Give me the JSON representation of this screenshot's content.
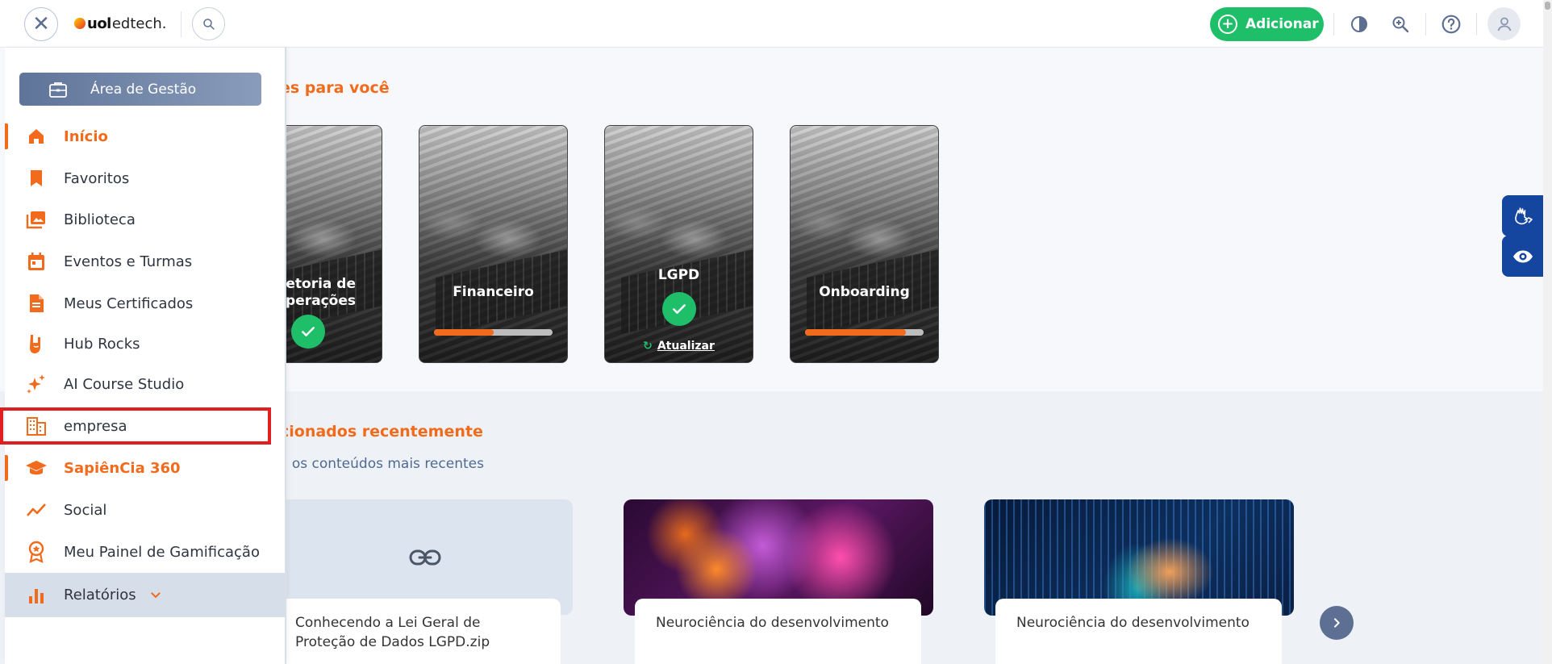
{
  "header": {
    "logo_uol": "uol",
    "logo_edtech": "edtech.",
    "add_label": "Adicionar"
  },
  "sidebar": {
    "management_label": "Área de Gestão",
    "items": [
      {
        "label": "Início",
        "icon": "home-icon",
        "active": true
      },
      {
        "label": "Favoritos",
        "icon": "bookmark-icon",
        "active": false
      },
      {
        "label": "Biblioteca",
        "icon": "library-icon",
        "active": false
      },
      {
        "label": "Eventos e Turmas",
        "icon": "calendar-icon",
        "active": false
      },
      {
        "label": "Meus Certificados",
        "icon": "certificate-icon",
        "active": false
      },
      {
        "label": "Hub Rocks",
        "icon": "rock-hand-icon",
        "active": false
      },
      {
        "label": "AI Course Studio",
        "icon": "sparkle-icon",
        "active": false
      },
      {
        "label": "empresa",
        "icon": "building-icon",
        "active": false
      },
      {
        "label": "SapiênCia 360",
        "icon": "graduation-cap-icon",
        "active": true
      },
      {
        "label": "Social",
        "icon": "trend-icon",
        "active": false
      },
      {
        "label": "Meu Painel de Gamificação",
        "icon": "medal-icon",
        "active": false
      },
      {
        "label": "Relatórios",
        "icon": "bar-chart-icon",
        "active": false
      }
    ]
  },
  "main": {
    "for_you_title": "es para você",
    "cards": [
      {
        "title": "etoria de\nperações",
        "status": "completed"
      },
      {
        "title": "Financeiro",
        "progress": 0.5
      },
      {
        "title": "LGPD",
        "status": "completed",
        "update_label": "Atualizar"
      },
      {
        "title": "Onboarding",
        "progress": 0.85
      }
    ],
    "recent_title": "cionados recentemente",
    "recent_subtitle": "a os conteúdos mais recentes",
    "recent_items": [
      {
        "title": "Conhecendo a Lei Geral de Proteção de Dados LGPD.zip"
      },
      {
        "title": "Neurociência do desenvolvimento"
      },
      {
        "title": "Neurociência do desenvolvimento"
      }
    ]
  },
  "colors": {
    "accent": "#f26b1d",
    "success": "#1fbf6a",
    "accessibility": "#1446a0"
  }
}
